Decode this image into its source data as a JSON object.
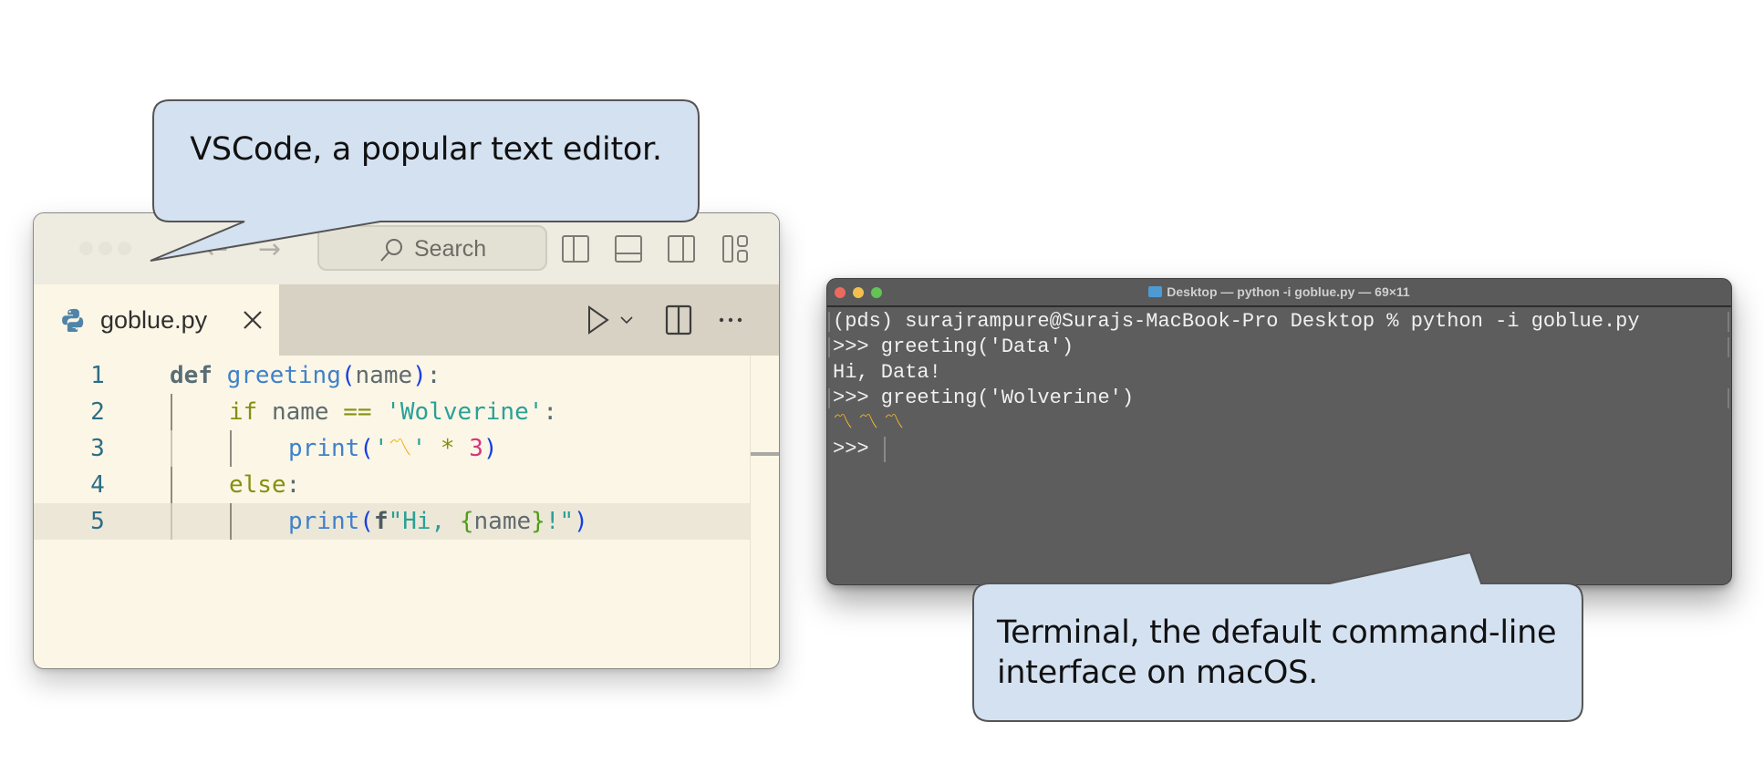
{
  "vscode": {
    "titlebar": {
      "back_arrow": "←",
      "forward_arrow": "→",
      "search_placeholder": "Search",
      "layout_icons": [
        "toggle-primary-sidebar-icon",
        "toggle-panel-icon",
        "toggle-secondary-sidebar-icon",
        "customize-layout-icon"
      ]
    },
    "tab": {
      "filename": "goblue.py",
      "close_glyph": "×"
    },
    "tab_actions": {
      "run_glyph": "▷",
      "run_dropdown_glyph": "⌄",
      "more_glyph": "···"
    },
    "code": {
      "line_numbers": [
        "1",
        "2",
        "3",
        "4",
        "5"
      ],
      "lines": [
        [
          {
            "t": "def",
            "c": "kw"
          },
          {
            "t": " ",
            "c": "punc"
          },
          {
            "t": "greeting",
            "c": "fn"
          },
          {
            "t": "(",
            "c": "paren"
          },
          {
            "t": "name",
            "c": "var"
          },
          {
            "t": ")",
            "c": "paren"
          },
          {
            "t": ":",
            "c": "punc"
          }
        ],
        [
          {
            "t": "if",
            "c": "ctl"
          },
          {
            "t": " name ",
            "c": "var"
          },
          {
            "t": "==",
            "c": "op"
          },
          {
            "t": " ",
            "c": "punc"
          },
          {
            "t": "'Wolverine'",
            "c": "str"
          },
          {
            "t": ":",
            "c": "punc"
          }
        ],
        [
          {
            "t": "print",
            "c": "fn"
          },
          {
            "t": "(",
            "c": "paren"
          },
          {
            "t": "'",
            "c": "str"
          },
          {
            "t": "〽",
            "c": "claw"
          },
          {
            "t": "'",
            "c": "str"
          },
          {
            "t": " ",
            "c": "punc"
          },
          {
            "t": "*",
            "c": "op"
          },
          {
            "t": " ",
            "c": "punc"
          },
          {
            "t": "3",
            "c": "num"
          },
          {
            "t": ")",
            "c": "paren"
          }
        ],
        [
          {
            "t": "else",
            "c": "ctl"
          },
          {
            "t": ":",
            "c": "punc"
          }
        ],
        [
          {
            "t": "print",
            "c": "fn"
          },
          {
            "t": "(",
            "c": "paren"
          },
          {
            "t": "f",
            "c": "fpre"
          },
          {
            "t": "\"Hi, ",
            "c": "str"
          },
          {
            "t": "{",
            "c": "brace"
          },
          {
            "t": "name",
            "c": "var"
          },
          {
            "t": "}",
            "c": "brace"
          },
          {
            "t": "!\"",
            "c": "str"
          },
          {
            "t": ")",
            "c": "paren"
          }
        ]
      ],
      "indent_levels": [
        0,
        1,
        2,
        1,
        2
      ],
      "highlighted_line": 5
    }
  },
  "terminal": {
    "title": "Desktop — python -i goblue.py — 69×11",
    "lines": [
      {
        "text": "(pds) surajrampure@Surajs-MacBook-Pro Desktop % python -i goblue.py",
        "marked": true,
        "kind": "normal"
      },
      {
        "text": ">>> greeting('Data')",
        "marked": true,
        "kind": "normal"
      },
      {
        "text": "Hi, Data!",
        "marked": false,
        "kind": "normal"
      },
      {
        "text": ">>> greeting('Wolverine')",
        "marked": true,
        "kind": "normal"
      },
      {
        "text": "〽〽〽",
        "marked": false,
        "kind": "claws"
      },
      {
        "text": ">>> ",
        "marked": false,
        "kind": "prompt"
      }
    ]
  },
  "callouts": {
    "vscode": "VSCode, a popular text editor.",
    "terminal_line1": "Terminal, the default command-line",
    "terminal_line2": "interface on macOS."
  },
  "colors": {
    "callout_fill": "#d4e1f1",
    "callout_stroke": "#555555",
    "editor_bg": "#fcf6e6",
    "terminal_bg": "#5d5d5d",
    "claw_yellow": "#f2b01e"
  }
}
